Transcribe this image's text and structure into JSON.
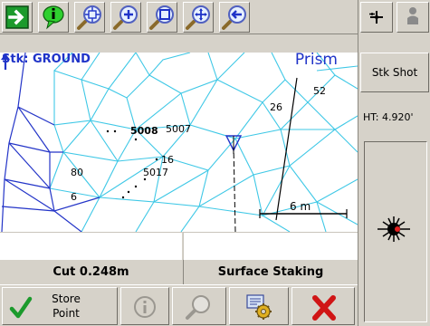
{
  "toolbar": {
    "buttons": [
      {
        "name": "next-arrow-icon"
      },
      {
        "name": "info-bubble-icon"
      },
      {
        "name": "zoom-extents-icon"
      },
      {
        "name": "zoom-in-icon"
      },
      {
        "name": "zoom-window-icon"
      },
      {
        "name": "pan-icon"
      },
      {
        "name": "previous-view-icon"
      }
    ]
  },
  "right_panel": {
    "stk_shot_label": "Stk Shot",
    "ht_label": "HT: 4.920'"
  },
  "map": {
    "stake_label": "Stk: GROUND",
    "prism_label": "Prism",
    "points": [
      {
        "label": "52"
      },
      {
        "label": "26"
      },
      {
        "label": "5008"
      },
      {
        "label": "5007"
      },
      {
        "label": "16"
      },
      {
        "label": "5017"
      },
      {
        "label": "80"
      },
      {
        "label": "6"
      }
    ],
    "scale_label": "6 m"
  },
  "status": {
    "cut_text": "Cut 0.248m",
    "mode_text": "Surface Staking"
  },
  "bottombar": {
    "store_point_line1": "Store",
    "store_point_line2": "Point"
  },
  "colors": {
    "tin_lines": "#3fc8e6",
    "dark_lines": "#2435c8",
    "accent_blue": "#1f33c8",
    "toolbar_green": "#22b14c",
    "close_red": "#d01515"
  }
}
